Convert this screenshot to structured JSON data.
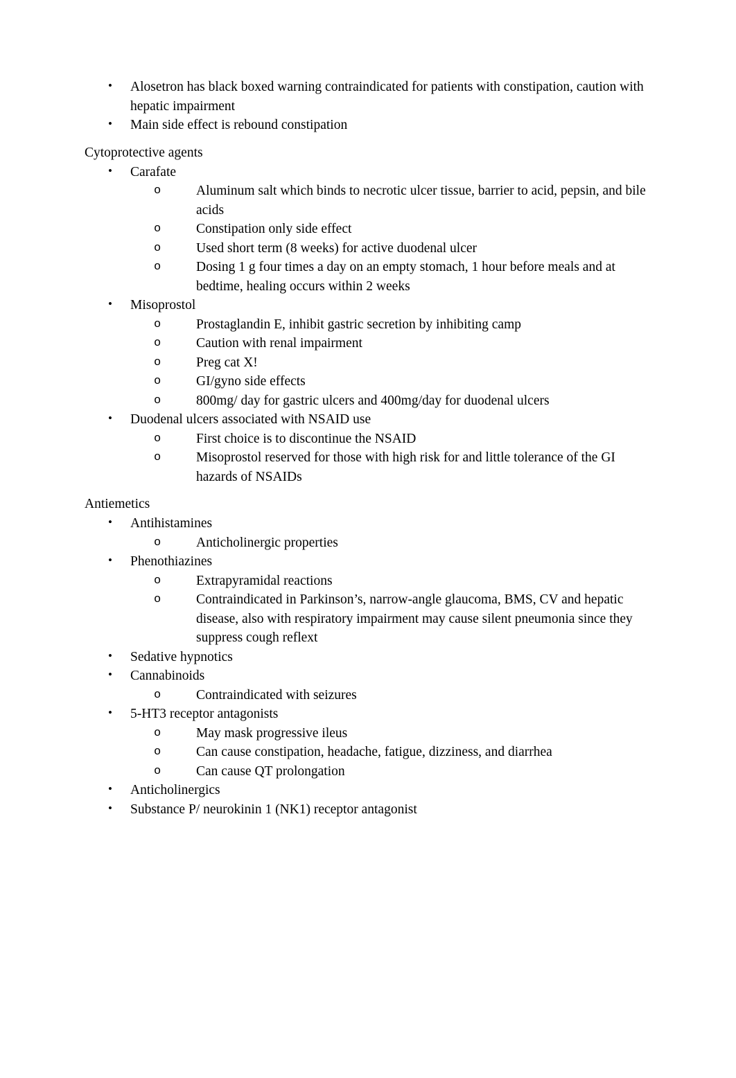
{
  "document": {
    "bullet_glyph": "•",
    "subbullet_glyph": "o",
    "blocks": [
      {
        "type": "list",
        "items": [
          {
            "text": "Alosetron has black boxed warning contraindicated for patients with constipation, caution with hepatic impairment",
            "children": []
          },
          {
            "text": "Main side effect is rebound constipation",
            "children": []
          }
        ]
      },
      {
        "type": "heading",
        "text": "Cytoprotective agents"
      },
      {
        "type": "list",
        "items": [
          {
            "text": "Carafate",
            "children": [
              "Aluminum salt which binds to necrotic ulcer tissue, barrier to acid, pepsin, and bile acids",
              "Constipation only side effect",
              "Used short term (8 weeks) for active duodenal ulcer",
              "Dosing 1 g four times a day on an empty stomach, 1 hour before meals and at bedtime, healing occurs within 2 weeks"
            ]
          },
          {
            "text": "Misoprostol",
            "children": [
              "Prostaglandin E, inhibit gastric secretion by inhibiting camp",
              "Caution with renal impairment",
              "Preg cat X!",
              "GI/gyno side effects",
              "800mg/ day for gastric ulcers and 400mg/day for duodenal ulcers"
            ]
          },
          {
            "text": "Duodenal ulcers associated with NSAID use",
            "children": [
              "First choice is to discontinue the NSAID",
              "Misoprostol reserved for those with high risk for and little tolerance of the GI hazards of NSAIDs"
            ]
          }
        ]
      },
      {
        "type": "heading",
        "text": "Antiemetics"
      },
      {
        "type": "list",
        "items": [
          {
            "text": "Antihistamines",
            "children": [
              "Anticholinergic properties"
            ]
          },
          {
            "text": "Phenothiazines",
            "children": [
              "Extrapyramidal reactions",
              "Contraindicated in Parkinson’s, narrow-angle glaucoma, BMS, CV and hepatic disease, also with respiratory impairment may cause silent pneumonia since they suppress cough reflext"
            ]
          },
          {
            "text": "Sedative hypnotics",
            "children": []
          },
          {
            "text": "Cannabinoids",
            "children": [
              "Contraindicated with seizures"
            ]
          },
          {
            "text": "5-HT3 receptor antagonists",
            "children": [
              "May mask progressive ileus",
              "Can cause constipation, headache, fatigue, dizziness, and diarrhea",
              "Can cause QT prolongation"
            ]
          },
          {
            "text": "Anticholinergics",
            "children": []
          },
          {
            "text": "Substance P/ neurokinin 1 (NK1) receptor antagonist",
            "children": []
          }
        ]
      }
    ]
  }
}
